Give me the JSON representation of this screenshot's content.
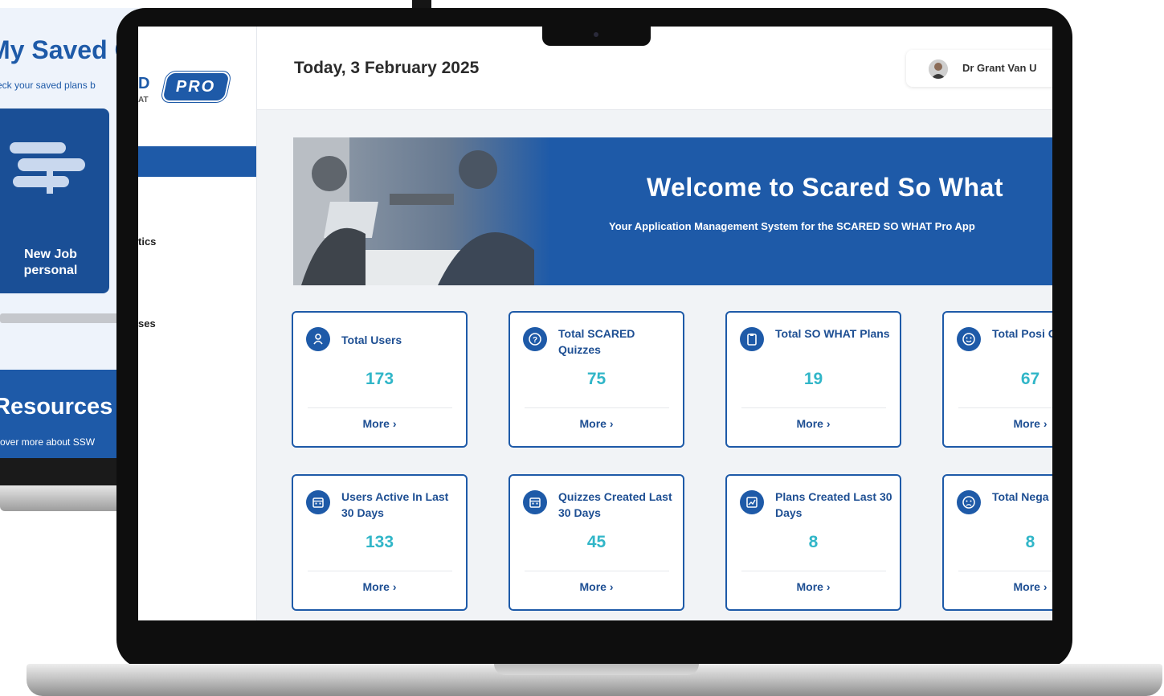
{
  "background_app": {
    "title": "My Saved C",
    "subtitle": "eck your saved plans b",
    "card_label": "New Job personal",
    "resources_title": "Resources",
    "resources_sub": "cover more about SSW"
  },
  "sidebar": {
    "logo_partial": "D",
    "logo_sub": "AT",
    "pro_badge": "PRO",
    "items": [
      {
        "label": "tics"
      },
      {
        "label": "ses"
      }
    ]
  },
  "header": {
    "date": "Today, 3 February 2025",
    "user_name": "Dr Grant Van U"
  },
  "banner": {
    "title": "Welcome to Scared So What",
    "subtitle": "Your Application Management System for the SCARED SO WHAT Pro App"
  },
  "cards": [
    {
      "title": "Total Users",
      "value": "173",
      "more": "More ›",
      "icon": "user-icon"
    },
    {
      "title": "Total SCARED Quizzes",
      "value": "75",
      "more": "More ›",
      "icon": "question-icon"
    },
    {
      "title": "Total SO WHAT Plans",
      "value": "19",
      "more": "More ›",
      "icon": "clipboard-icon"
    },
    {
      "title": "Total Posi Outcomes",
      "value": "67",
      "more": "More ›",
      "icon": "smile-icon"
    },
    {
      "title": "Users Active In Last 30 Days",
      "value": "133",
      "more": "More ›",
      "icon": "calendar-icon"
    },
    {
      "title": "Quizzes Created Last 30 Days",
      "value": "45",
      "more": "More ›",
      "icon": "calendar-icon"
    },
    {
      "title": "Plans Created Last 30 Days",
      "value": "8",
      "more": "More ›",
      "icon": "chart-icon"
    },
    {
      "title": "Total Nega Outcomes",
      "value": "8",
      "more": "More ›",
      "icon": "sad-icon"
    }
  ],
  "colors": {
    "brand_blue": "#1e5aa8",
    "value_teal": "#31b6c8"
  }
}
